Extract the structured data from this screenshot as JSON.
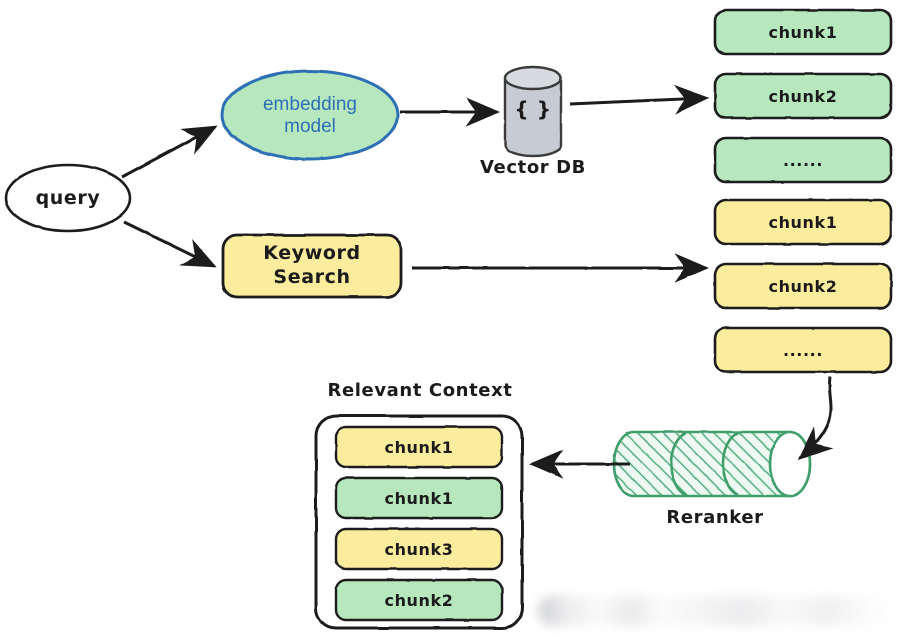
{
  "diagram": {
    "title": "Hybrid Retrieval with Reranking (RAG) flow diagram",
    "colors": {
      "green_fill": "#b7e8bd",
      "green_stroke": "#1f1f1f",
      "yellow_fill": "#fcec9e",
      "yellow_stroke": "#1f1f1f",
      "blue_stroke": "#2f6fb5",
      "blue_text": "#2f6fb5",
      "grey_fill": "#c7ccd3",
      "grey_stroke": "#3a3a3a",
      "reranker_green": "#3f9e6d",
      "ink": "#1b1b1b",
      "white": "#ffffff"
    },
    "nodes": {
      "query": {
        "label": "query",
        "shape": "ellipse"
      },
      "embedding_model": {
        "label": "embedding\nmodel",
        "shape": "ellipse"
      },
      "keyword_search": {
        "label": "Keyword\nSearch",
        "shape": "rounded-rect"
      },
      "vector_db": {
        "body_label": "{ }",
        "caption": "Vector DB",
        "shape": "cylinder"
      },
      "reranker": {
        "caption": "Reranker",
        "shape": "horizontal-cylinder",
        "segments": 3
      }
    },
    "vector_results": {
      "group": "vector-search-results",
      "items": [
        {
          "label": "chunk1",
          "color": "green"
        },
        {
          "label": "chunk2",
          "color": "green"
        },
        {
          "label": "......",
          "color": "green"
        }
      ]
    },
    "keyword_results": {
      "group": "keyword-search-results",
      "items": [
        {
          "label": "chunk1",
          "color": "yellow"
        },
        {
          "label": "chunk2",
          "color": "yellow"
        },
        {
          "label": "......",
          "color": "yellow"
        }
      ]
    },
    "relevant_context": {
      "caption": "Relevant Context",
      "items": [
        {
          "label": "chunk1",
          "color": "yellow"
        },
        {
          "label": "chunk1",
          "color": "green"
        },
        {
          "label": "chunk3",
          "color": "yellow"
        },
        {
          "label": "chunk2",
          "color": "green"
        }
      ]
    },
    "edges": [
      {
        "from": "query",
        "to": "embedding_model",
        "style": "straight-arrow"
      },
      {
        "from": "query",
        "to": "keyword_search",
        "style": "straight-arrow"
      },
      {
        "from": "embedding_model",
        "to": "vector_db",
        "style": "straight-arrow"
      },
      {
        "from": "vector_db",
        "to": "vector_results",
        "style": "straight-arrow"
      },
      {
        "from": "keyword_search",
        "to": "keyword_results",
        "style": "straight-arrow"
      },
      {
        "from": "keyword_results",
        "to": "reranker",
        "style": "curved-arrow"
      },
      {
        "from": "reranker",
        "to": "relevant_context",
        "style": "straight-arrow-left"
      }
    ],
    "watermark": {
      "label": "",
      "state": "blurred"
    }
  }
}
